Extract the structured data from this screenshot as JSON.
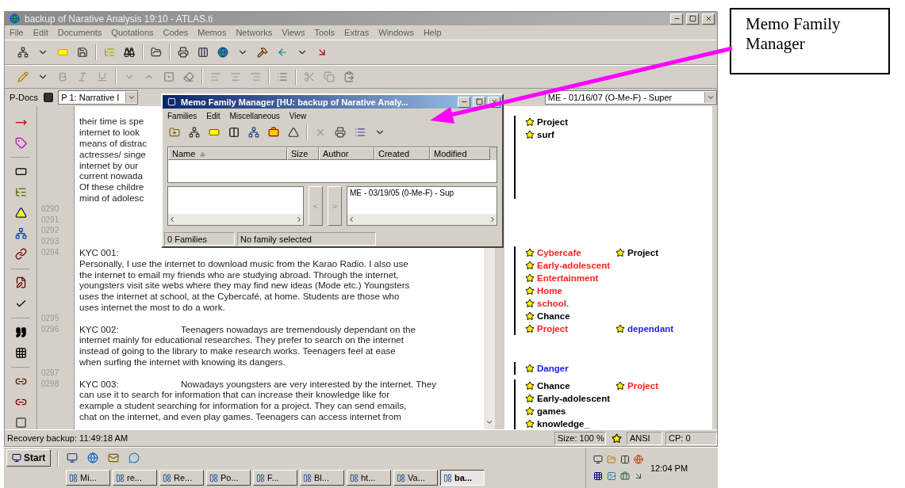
{
  "window": {
    "title": "backup of Narative Analysis 19:10 - ATLAS.ti",
    "menu": [
      "File",
      "Edit",
      "Documents",
      "Quotations",
      "Codes",
      "Memos",
      "Networks",
      "Views",
      "Tools",
      "Extras",
      "Windows",
      "Help"
    ]
  },
  "pdocs": {
    "label": "P-Docs",
    "value": "P 1: Narrative I"
  },
  "memo_selector": {
    "value": "ME - 01/16/07 (O-Me-F) - Super"
  },
  "document": {
    "lines": [
      {
        "text": "their time is spe"
      },
      {
        "text": "internet to look"
      },
      {
        "text": "means of distrac"
      },
      {
        "text": "actresses/ singe"
      },
      {
        "text": "internet by our"
      },
      {
        "text": "current nowada"
      },
      {
        "text": "Of these childre"
      },
      {
        "text": "mind of adolesc"
      },
      {
        "number": "0290"
      },
      {
        "number": "0291"
      },
      {
        "number": "0292"
      },
      {
        "number": "0293"
      },
      {
        "number": "0294",
        "label": "KYC 001:"
      },
      {
        "text": "Personally, I use the internet to download music from the Karao Radio. I also use"
      },
      {
        "text": "the internet to email my friends who are studying abroad. Through the internet,"
      },
      {
        "text": "youngsters visit site webs where they may find new ideas (Mode etc.) Youngsters"
      },
      {
        "text": "uses the internet at school, at the Cybercafé, at home. Students are those who"
      },
      {
        "text": "uses internet the most to do a work."
      },
      {
        "number": "0295"
      },
      {
        "number": "0296",
        "label": "KYC 002:",
        "text": "Teenagers nowadays are tremendously dependant on the"
      },
      {
        "text": "internet mainly for educational researches. They prefer to search on the internet"
      },
      {
        "text": "instead of going to the library to make research works. Teenagers feel at ease"
      },
      {
        "text": "when surfing the internet with knowing its dangers."
      },
      {
        "number": "0297"
      },
      {
        "number": "0298",
        "label": "KYC 003:",
        "text": "Nowadays youngsters are very interested by the internet. They"
      },
      {
        "text": "can use it to search for information that can increase their knowledge like for"
      },
      {
        "text": "example a student searching for information for a project. They can send emails,"
      },
      {
        "text": "chat on the internet, and even play games. Teenagers can access internet from"
      }
    ]
  },
  "margin": {
    "groups": [
      {
        "rows": [
          {
            "codes": [
              {
                "label": "Project",
                "color": "#000000"
              }
            ]
          },
          {
            "codes": [
              {
                "label": "surf",
                "color": "#000000"
              }
            ]
          }
        ]
      },
      {
        "rows": [
          {
            "codes": [
              {
                "label": "Cybercafe",
                "color": "#ff2020"
              },
              {
                "label": "Project",
                "color": "#000000"
              }
            ]
          },
          {
            "codes": [
              {
                "label": "Early-adolescent",
                "color": "#ff2020"
              }
            ]
          },
          {
            "codes": [
              {
                "label": "Entertainment",
                "color": "#ff2020"
              }
            ]
          },
          {
            "codes": [
              {
                "label": "Home",
                "color": "#ff2020"
              }
            ]
          },
          {
            "codes": [
              {
                "label": "school.",
                "color": "#ff2020"
              }
            ]
          },
          {
            "codes": [
              {
                "label": "Chance",
                "color": "#000000"
              }
            ]
          },
          {
            "codes": [
              {
                "label": "Project",
                "color": "#ff2020"
              },
              {
                "label": "dependant",
                "color": "#2020ff"
              }
            ]
          }
        ]
      },
      {
        "rows": [
          {
            "codes": [
              {
                "label": "Danger",
                "color": "#2020ff"
              }
            ]
          }
        ]
      },
      {
        "rows": [
          {
            "codes": [
              {
                "label": "Chance",
                "color": "#000000"
              },
              {
                "label": "Project",
                "color": "#ff2020"
              }
            ]
          },
          {
            "codes": [
              {
                "label": "Early-adolescent",
                "color": "#000000"
              }
            ]
          },
          {
            "codes": [
              {
                "label": "games",
                "color": "#000000"
              }
            ]
          },
          {
            "codes": [
              {
                "label": "knowledge_",
                "color": "#000000"
              }
            ]
          }
        ]
      }
    ]
  },
  "status_bar": {
    "text": "Recovery backup: 11:49:18 AM",
    "size": "Size: 100 %",
    "encoding": "ANSI",
    "cp": "CP: 0"
  },
  "dialog": {
    "title": "Memo Family Manager [HU: backup of Narative Analy...",
    "menu": [
      "Families",
      "Edit",
      "Miscellaneous",
      "View"
    ],
    "columns": [
      "Name",
      "Size",
      "Author",
      "Created",
      "Modified"
    ],
    "move_buttons": [
      "<",
      ">"
    ],
    "right_list": [
      "ME - 03/19/05 (0-Me-F) - Sup"
    ],
    "status": [
      "0 Families",
      "No family selected"
    ]
  },
  "taskbar": {
    "start": "Start",
    "clock": "12:04 PM",
    "tasks": [
      {
        "label": "Mi...",
        "selected": false
      },
      {
        "label": "re...",
        "selected": false
      },
      {
        "label": "Re...",
        "selected": false
      },
      {
        "label": "Po...",
        "selected": false
      },
      {
        "label": "F...",
        "selected": false
      },
      {
        "label": "Bl...",
        "selected": false
      },
      {
        "label": "ht...",
        "selected": false
      },
      {
        "label": "Va...",
        "selected": false
      },
      {
        "label": "ba...",
        "selected": true
      }
    ]
  },
  "callout": {
    "text": "Memo Family Manager"
  }
}
